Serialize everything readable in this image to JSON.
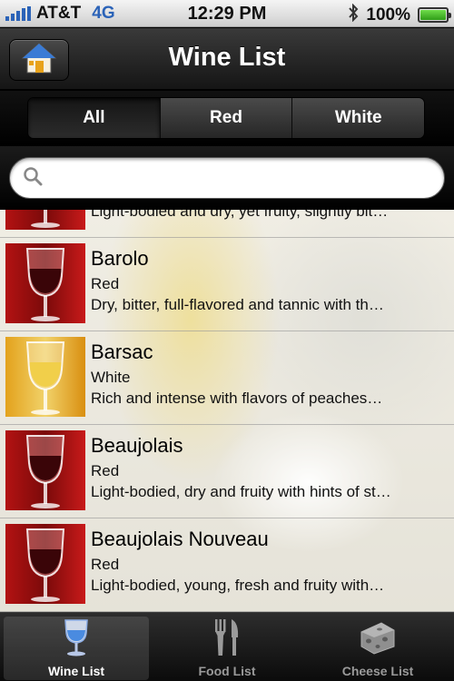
{
  "status_bar": {
    "carrier": "AT&T",
    "network": "4G",
    "time": "12:29 PM",
    "battery": "100%",
    "icons": [
      "signal-icon",
      "bluetooth-icon",
      "battery-icon"
    ],
    "battery_level": 1.0
  },
  "nav": {
    "title": "Wine List",
    "home_icon": "home-icon"
  },
  "filter": {
    "segments": [
      "All",
      "Red",
      "White"
    ],
    "selected": "All"
  },
  "search": {
    "placeholder": "",
    "value": "",
    "icon": "search-icon"
  },
  "wines": [
    {
      "name": "",
      "type": "",
      "description": "Light-bodied and dry, yet fruity, slightly bit…",
      "color": "red"
    },
    {
      "name": "Barolo",
      "type": "Red",
      "description": "Dry, bitter, full-flavored and tannic with th…",
      "color": "red"
    },
    {
      "name": "Barsac",
      "type": "White",
      "description": "Rich and intense with flavors of peaches…",
      "color": "white"
    },
    {
      "name": "Beaujolais",
      "type": "Red",
      "description": "Light-bodied, dry and fruity with hints of st…",
      "color": "red"
    },
    {
      "name": "Beaujolais Nouveau",
      "type": "Red",
      "description": "Light-bodied, young, fresh and fruity with…",
      "color": "red"
    }
  ],
  "tabs": [
    {
      "label": "Wine List",
      "icon": "wine-glass-icon",
      "active": true
    },
    {
      "label": "Food List",
      "icon": "fork-knife-icon",
      "active": false
    },
    {
      "label": "Cheese List",
      "icon": "cheese-icon",
      "active": false
    }
  ],
  "colors": {
    "network_blue": "#2b63b8",
    "red_wine": "#8a0a10",
    "white_wine": "#e8c54a"
  }
}
